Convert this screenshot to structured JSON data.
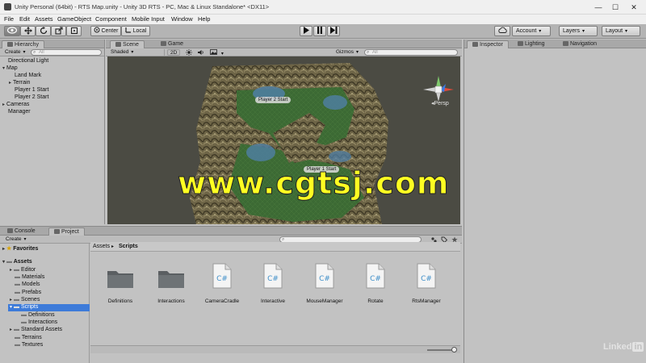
{
  "window": {
    "title": "Unity Personal (64bit) - RTS Map.unity - Unity 3D RTS - PC, Mac & Linux Standalone* <DX11>",
    "controls": [
      "—",
      "☐",
      "✕"
    ]
  },
  "menu": [
    "File",
    "Edit",
    "Assets",
    "GameObject",
    "Component",
    "Mobile Input",
    "Window",
    "Help"
  ],
  "toolbar": {
    "pivot_mode": "Center",
    "pivot_rotation": "Local",
    "account": "Account",
    "layers": "Layers",
    "layout": "Layout"
  },
  "hierarchy": {
    "tab": "Hierarchy",
    "create": "Create",
    "search_placeholder": "All",
    "items": [
      "Directional Light",
      "Map",
      "Land Mark",
      "Terrain",
      "Player 1 Start",
      "Player 2 Start",
      "Cameras",
      "Manager"
    ]
  },
  "scene": {
    "tabs": [
      "Scene",
      "Game"
    ],
    "shading": "Shaded",
    "mode_2d": "2D",
    "gizmos": "Gizmos",
    "search_placeholder": "All",
    "projection": "Persp",
    "labels": [
      "Player 2 Start",
      "Player 1 Start"
    ],
    "colors": {
      "terrain_rock": "#6e6547",
      "grass": "#3c6a34",
      "water": "#4f7fa5",
      "background": "#4b4b43"
    }
  },
  "inspector": {
    "tabs": [
      "Inspector",
      "Lighting",
      "Navigation"
    ]
  },
  "project": {
    "tabs": [
      "Console",
      "Project"
    ],
    "create": "Create",
    "favorites": "Favorites",
    "tree": [
      "Assets",
      "Editor",
      "Materials",
      "Models",
      "Prefabs",
      "Scenes",
      "Scripts",
      "Definitions",
      "Interactions",
      "Standard Assets",
      "Terrains",
      "Textures"
    ],
    "selected": "Scripts",
    "breadcrumb": [
      "Assets",
      "Scripts"
    ],
    "breadcrumb_sep": "▸",
    "assets": [
      {
        "name": "Definitions",
        "kind": "folder"
      },
      {
        "name": "Interactions",
        "kind": "folder"
      },
      {
        "name": "CameraCradle",
        "kind": "script"
      },
      {
        "name": "Interactive",
        "kind": "script"
      },
      {
        "name": "MouseManager",
        "kind": "script"
      },
      {
        "name": "Rotate",
        "kind": "script"
      },
      {
        "name": "RtsManager",
        "kind": "script"
      }
    ],
    "cs_glyph": "C#"
  },
  "overlays": {
    "watermark": "www.cgtsj.com",
    "linkedin_a": "Linked",
    "linkedin_b": "in"
  }
}
